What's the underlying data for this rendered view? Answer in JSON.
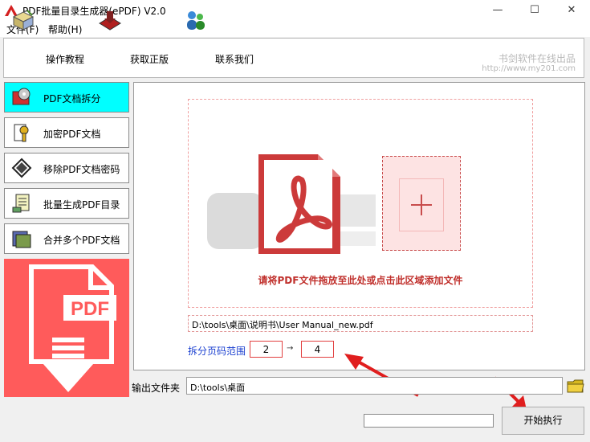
{
  "window": {
    "title": "PDF批量目录生成器(ePDF) V2.0",
    "minimize_glyph": "—",
    "maximize_glyph": "☐",
    "close_glyph": "✕"
  },
  "menu": {
    "items": [
      "文件(F)",
      "帮助(H)"
    ]
  },
  "toolbar": {
    "buttons": [
      {
        "label": "操作教程",
        "icon": "tutorial-icon"
      },
      {
        "label": "获取正版",
        "icon": "genuine-icon"
      },
      {
        "label": "联系我们",
        "icon": "contact-icon"
      }
    ],
    "brand_cn": "书剑软件在线出品",
    "brand_url": "http://www.my201.com"
  },
  "sidebar": {
    "items": [
      {
        "label": "PDF文档拆分",
        "icon": "split-icon",
        "active": true
      },
      {
        "label": "加密PDF文档",
        "icon": "key-icon",
        "active": false
      },
      {
        "label": "移除PDF文档密码",
        "icon": "unlock-icon",
        "active": false
      },
      {
        "label": "批量生成PDF目录",
        "icon": "catalog-icon",
        "active": false
      },
      {
        "label": "合并多个PDF文档",
        "icon": "merge-icon",
        "active": false
      }
    ],
    "panel_text": "PDF"
  },
  "main": {
    "drop_hint": "请将PDF文件拖放至此处或点击此区域添加文件",
    "file_path": "D:\\tools\\桌面\\说明书\\User Manual_new.pdf",
    "range_label": "拆分页码范围",
    "range_from": "2",
    "range_arrow": "→",
    "range_to": "4"
  },
  "output": {
    "label": "输出文件夹",
    "value": "D:\\tools\\桌面"
  },
  "progress": 0,
  "start_button": "开始执行",
  "colors": {
    "accent_red": "#e04848",
    "active_tab": "#00ffff",
    "panel_red": "#ff5b5b"
  }
}
